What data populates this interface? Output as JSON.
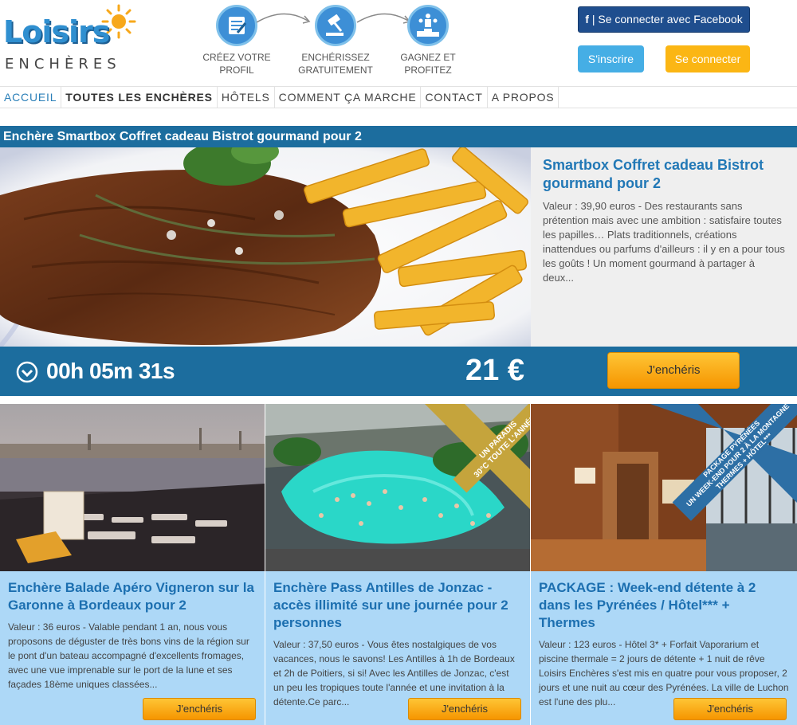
{
  "logo": {
    "main": "Loisirs",
    "sub": "ENCHÈRES"
  },
  "steps": [
    {
      "icon": "profile-form-icon",
      "label": "CRÉEZ VOTRE PROFIL"
    },
    {
      "icon": "auction-gavel-icon",
      "label_line1": "ENCHÉRISSEZ",
      "label_line2": "GRATUITEMENT"
    },
    {
      "icon": "winner-podium-icon",
      "label": "GAGNEZ ET PROFITEZ"
    }
  ],
  "auth": {
    "facebook_label": "Se connecter avec Facebook",
    "signup_label": "S'inscrire",
    "login_label": "Se connecter"
  },
  "nav": [
    {
      "label": "ACCUEIL"
    },
    {
      "label": "TOUTES LES ENCHÈRES"
    },
    {
      "label": "HÔTELS"
    },
    {
      "label": "COMMENT ÇA MARCHE"
    },
    {
      "label": "CONTACT"
    },
    {
      "label": "A PROPOS"
    }
  ],
  "featured": {
    "bar_title": "Enchère Smartbox Coffret cadeau Bistrot gourmand pour 2",
    "title": "Smartbox Coffret cadeau Bistrot gourmand pour 2",
    "description": "Valeur : 39,90 euros - Des restaurants sans prétention mais avec une ambition : satisfaire toutes les papilles… Plats traditionnels, créations inattendues ou parfums d'ailleurs : il y en a pour tous les goûts ! Un moment gourmand à partager à deux...",
    "timer": "00h 05m 31s",
    "price": "21 €",
    "bid_label": "J'enchéris"
  },
  "cards": [
    {
      "title": "Enchère Balade Apéro Vigneron sur la Garonne à Bordeaux pour 2",
      "description": "Valeur : 36 euros - Valable pendant 1 an, nous vous proposons de déguster de très bons vins de la région sur le pont d'un bateau accompagné d'excellents fromages, avec une vue imprenable sur le port de la lune et ses façades 18ème uniques classées...",
      "bid_label": "J'enchéris"
    },
    {
      "title": "Enchère Pass Antilles de Jonzac - accès illimité sur une journée pour 2 personnes",
      "description": "Valeur : 37,50 euros - Vous êtes nostalgiques de vos vacances, nous le savons! Les Antilles à 1h de Bordeaux et 2h de Poitiers, si si! Avec les Antilles de Jonzac, c'est un peu les tropiques toute l'année et une invitation à la détente.Ce parc...",
      "ribbon_line1": "UN PARADIS",
      "ribbon_line2": "30°C TOUTE L'ANNÉE",
      "bid_label": "J'enchéris"
    },
    {
      "title": "PACKAGE : Week-end détente à 2 dans les Pyrénées / Hôtel*** + Thermes",
      "description": "Valeur : 123 euros - Hôtel 3* + Forfait Vaporarium et piscine thermale = 2 jours de détente + 1 nuit de rêve Loisirs Enchères s'est mis en quatre pour vous proposer, 2 jours et une nuit au cœur des Pyrénées. La ville de Luchon est l'une des plu...",
      "ribbon_line1": "PACKAGE PYRÉNÉES",
      "ribbon_line2": "UN WEEK-END POUR 2 À LA MONTAGNE",
      "ribbon_line3": "THERMES + HÔTEL***",
      "bid_label": "J'enchéris"
    }
  ],
  "colors": {
    "primary_blue": "#1c6d9e",
    "link_blue": "#2178b6",
    "card_bg": "#add8f7",
    "orange": "#fbb614",
    "facebook": "#1f4e8e",
    "signup": "#45aee5"
  }
}
